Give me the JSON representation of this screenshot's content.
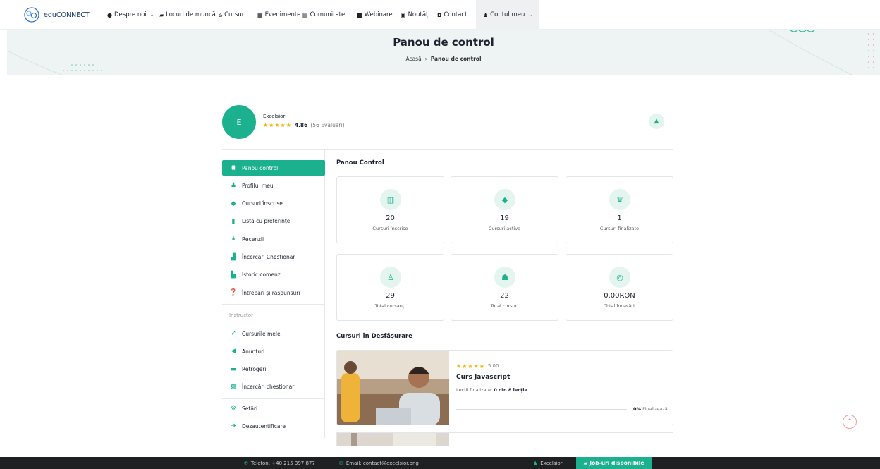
{
  "brand": {
    "name": "eduCONNECT",
    "logo": "edu-connect-logo"
  },
  "nav": [
    {
      "label": "Despre noi",
      "icon": "info-icon",
      "ic": "●",
      "dropdown": true
    },
    {
      "label": "Locuri de muncă",
      "icon": "briefcase-icon",
      "ic": "▰",
      "dropdown": true
    },
    {
      "label": "Cursuri",
      "icon": "chalkboard-icon",
      "ic": "⌂",
      "dropdown": false
    },
    {
      "label": "Evenimente",
      "icon": "calendar-icon",
      "ic": "▦",
      "dropdown": false
    },
    {
      "label": "Comunitate",
      "icon": "community-icon",
      "ic": "▤",
      "dropdown": false
    },
    {
      "label": "Webinare",
      "icon": "video-icon",
      "ic": "■",
      "dropdown": false
    },
    {
      "label": "Noutăți",
      "icon": "news-icon",
      "ic": "▣",
      "dropdown": false
    },
    {
      "label": "Contact",
      "icon": "contact-icon",
      "ic": "◘",
      "dropdown": false
    },
    {
      "label": "Contul meu",
      "icon": "user-cog-icon",
      "ic": "♟",
      "dropdown": true
    }
  ],
  "hero": {
    "title": "Panou de control",
    "breadcrumb": {
      "home": "Acasă",
      "sep": "›",
      "current": "Panou de control"
    }
  },
  "profile": {
    "initial": "E",
    "name": "Excelsior",
    "stars": "★★★★★",
    "rating": "4.86",
    "reviews": "(56 Evaluări)",
    "bell_icon": "bell-icon"
  },
  "sidebar": {
    "student": [
      {
        "label": "Panou control",
        "icon": "dashboard-icon",
        "ic": "◉",
        "active": true
      },
      {
        "label": "Profilul meu",
        "icon": "user-icon",
        "ic": "♟",
        "active": false
      },
      {
        "label": "Cursuri înscrise",
        "icon": "graduation-cap-icon",
        "ic": "◆",
        "active": false
      },
      {
        "label": "Listă cu preferințe",
        "icon": "bookmark-icon",
        "ic": "▮",
        "active": false
      },
      {
        "label": "Recenzii",
        "icon": "star-icon",
        "ic": "★",
        "active": false
      },
      {
        "label": "Încercări Chestionar",
        "icon": "sitemap-icon",
        "ic": "▟",
        "active": false
      },
      {
        "label": "Istoric comenzi",
        "icon": "cart-icon",
        "ic": "▙",
        "active": false
      },
      {
        "label": "Întrebări și răspunsuri",
        "icon": "qa-icon",
        "ic": "❓",
        "active": false
      }
    ],
    "instructor_label": "Instructor",
    "instructor": [
      {
        "label": "Cursurile mele",
        "icon": "rocket-icon",
        "ic": "➶"
      },
      {
        "label": "Anunțuri",
        "icon": "megaphone-icon",
        "ic": "◀"
      },
      {
        "label": "Retrogeri",
        "icon": "wallet-icon",
        "ic": "▬"
      },
      {
        "label": "Încercări chestionar",
        "icon": "question-icon",
        "ic": "▩"
      }
    ],
    "settings": [
      {
        "label": "Setări",
        "icon": "gear-icon",
        "ic": "⚙"
      },
      {
        "label": "Dezautentificare",
        "icon": "logout-icon",
        "ic": "➜"
      }
    ]
  },
  "dashboard": {
    "title": "Panou Control",
    "stats": [
      {
        "value": "20",
        "label": "Cursuri înscrise",
        "icon": "book-open-icon",
        "ic": "▥"
      },
      {
        "value": "19",
        "label": "Cursuri active",
        "icon": "graduation-cap-icon",
        "ic": "◆"
      },
      {
        "value": "1",
        "label": "Cursuri finalizate",
        "icon": "trophy-icon",
        "ic": "♛"
      },
      {
        "value": "29",
        "label": "Total cursanți",
        "icon": "student-icon",
        "ic": "♙"
      },
      {
        "value": "22",
        "label": "Total cursuri",
        "icon": "users-icon",
        "ic": "☗"
      },
      {
        "value": "0.00RON",
        "label": "Total încasări",
        "icon": "coins-icon",
        "ic": "◎"
      }
    ]
  },
  "in_progress": {
    "title": "Cursuri în Desfășurare",
    "course": {
      "stars": "★★★★★",
      "rating": "5.00",
      "title": "Curs Javascript",
      "lessons_label": "Lecții finalizate:",
      "lessons_value": "0 din 8 lecție",
      "progress": 0,
      "progress_pct": "0%",
      "progress_label": "Finalizează"
    }
  },
  "footer": {
    "phone": "Telefon: +40 215 397 877",
    "email": "Email: contact@excelsior.ong",
    "user": "Excelsior",
    "jobs": "Job-uri disponibile"
  },
  "colors": {
    "accent": "#1cb18e",
    "hero_bg": "#eef3f3",
    "footer_bg": "#1f2022",
    "star": "#f5b000"
  }
}
